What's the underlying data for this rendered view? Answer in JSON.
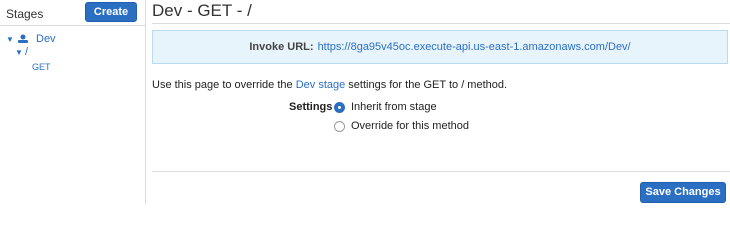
{
  "sidebar": {
    "title": "Stages",
    "create_label": "Create",
    "tree": {
      "stage_label": "Dev",
      "resource_label": "/",
      "method_label": "GET"
    }
  },
  "main": {
    "title": "Dev - GET - /",
    "invoke": {
      "label": "Invoke URL:",
      "url": "https://8ga95v45oc.execute-api.us-east-1.amazonaws.com/Dev/"
    },
    "description": {
      "prefix": "Use this page to override the ",
      "link": "Dev stage",
      "suffix": " settings for the GET to / method."
    },
    "settings": {
      "label": "Settings",
      "options": [
        {
          "label": "Inherit from stage",
          "selected": true
        },
        {
          "label": "Override for this method",
          "selected": false
        }
      ]
    },
    "save_label": "Save Changes"
  },
  "colors": {
    "accent": "#2b6fc2",
    "info_bg": "#e8f4fb"
  }
}
